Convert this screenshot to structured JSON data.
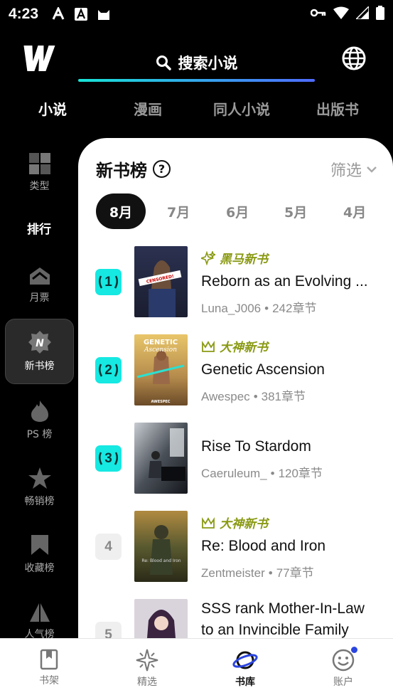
{
  "status_bar": {
    "time": "4:23",
    "icons_left": [
      "a11y-icon",
      "a-box-icon",
      "cat-icon"
    ],
    "icons_right": [
      "key-icon",
      "wifi-icon",
      "signal-icon",
      "battery-icon"
    ]
  },
  "header": {
    "logo": "W",
    "search_label": "搜索小说",
    "globe_icon": "globe-icon"
  },
  "category_tabs": [
    {
      "label": "小说",
      "active": true
    },
    {
      "label": "漫画",
      "active": false
    },
    {
      "label": "同人小说",
      "active": false
    },
    {
      "label": "出版书",
      "active": false
    }
  ],
  "sidebar": {
    "items": [
      {
        "label": "类型",
        "icon": "grid-icon"
      },
      {
        "label": "排行",
        "heading": true
      },
      {
        "label": "月票",
        "icon": "ticket-icon"
      },
      {
        "label": "新书榜",
        "icon": "new-badge-icon",
        "active": true
      },
      {
        "label": "PS 榜",
        "icon": "flame-icon"
      },
      {
        "label": "畅销榜",
        "icon": "star-icon"
      },
      {
        "label": "收藏榜",
        "icon": "bookmark-icon"
      },
      {
        "label": "人气榜",
        "icon": "pyramid-icon"
      }
    ]
  },
  "panel": {
    "title": "新书榜",
    "help_icon": "?",
    "filter_label": "筛选",
    "months": [
      {
        "label": "8月",
        "active": true
      },
      {
        "label": "7月"
      },
      {
        "label": "6月"
      },
      {
        "label": "5月"
      },
      {
        "label": "4月"
      }
    ],
    "books": [
      {
        "rank": "1",
        "tag": "黑马新书",
        "tag_icon": "sparkle-icon",
        "title": "Reborn as an Evolving ...",
        "author": "Luna_J006",
        "dot": "•",
        "chapters": "242章节"
      },
      {
        "rank": "2",
        "tag": "大神新书",
        "tag_icon": "crown-icon",
        "title": "Genetic Ascension",
        "author": "Awespec",
        "dot": "•",
        "chapters": "381章节"
      },
      {
        "rank": "3",
        "tag": "",
        "title": "Rise To Stardom",
        "author": "Caeruleum_",
        "dot": "•",
        "chapters": "120章节"
      },
      {
        "rank": "4",
        "tag": "大神新书",
        "tag_icon": "crown-icon",
        "title": "Re: Blood and Iron",
        "author": "Zentmeister",
        "dot": "•",
        "chapters": "77章节"
      },
      {
        "rank": "5",
        "tag": "",
        "title_line1": "SSS rank Mother-In-Law",
        "title_line2": "to an Invincible Family"
      }
    ],
    "cover_texts": {
      "b1": "CENSORED!",
      "b2a": "GENETIC",
      "b2b": "Ascension",
      "b2c": "AWESPEC",
      "b4": "Re: Blood and Iron"
    }
  },
  "bottom_nav": [
    {
      "label": "书架",
      "icon": "bookshelf-icon"
    },
    {
      "label": "精选",
      "icon": "sparkle-star-icon"
    },
    {
      "label": "书库",
      "icon": "planet-icon",
      "active": true
    },
    {
      "label": "账户",
      "icon": "smiley-icon"
    }
  ],
  "colors": {
    "accent_teal": "#16e8e2",
    "tag_olive": "#8a9a14",
    "nav_active_blue": "#2b45e0"
  }
}
